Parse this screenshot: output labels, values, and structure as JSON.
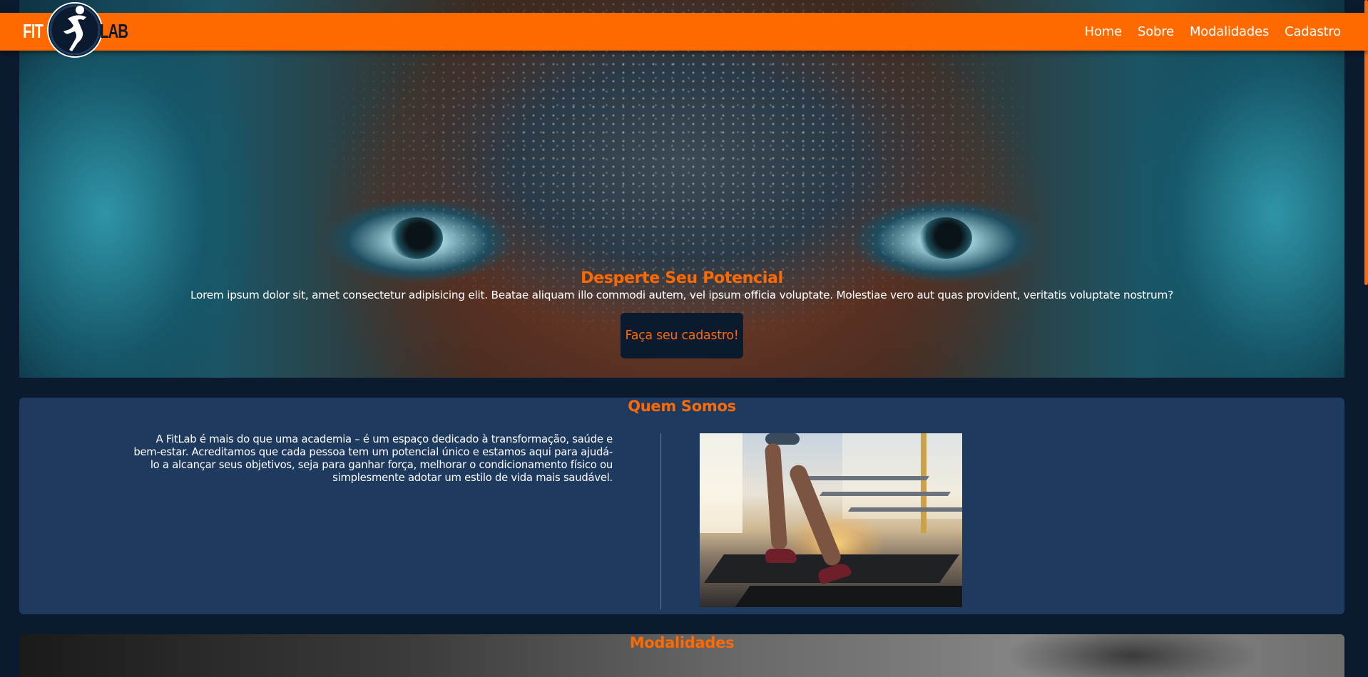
{
  "brand": {
    "logo_left": "FIT",
    "logo_right": "LAB",
    "accent_color": "#ff6a00",
    "navbar_color": "#ff6a00",
    "background_color": "#0b1a2e",
    "panel_color": "#1e3a5f"
  },
  "nav": {
    "items": [
      {
        "label": "Home"
      },
      {
        "label": "Sobre"
      },
      {
        "label": "Modalidades"
      },
      {
        "label": "Cadastro"
      }
    ]
  },
  "hero": {
    "title": "Desperte Seu Potencial",
    "text": "Lorem ipsum dolor sit, amet consectetur adipisicing elit. Beatae aliquam illo commodi autem, vel ipsum officia voluptate. Molestiae vero aut quas provident, veritatis voluptate nostrum?",
    "button_label": "Faça seu cadastro!"
  },
  "about": {
    "title": "Quem Somos",
    "text": "A FitLab é mais do que uma academia – é um espaço dedicado à transformação, saúde e bem-estar. Acreditamos que cada pessoa tem um potencial único e estamos aqui para ajudá-lo a alcançar seus objetivos, seja para ganhar força, melhorar o condicionamento físico ou simplesmente adotar um estilo de vida mais saudável."
  },
  "modalidades": {
    "title": "Modalidades"
  }
}
